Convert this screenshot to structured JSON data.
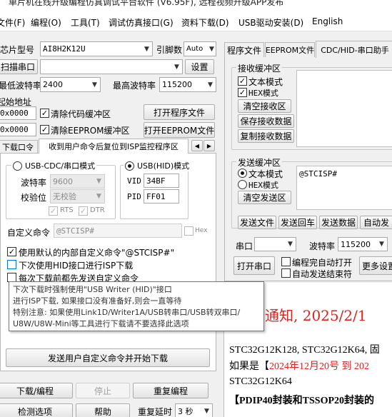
{
  "window": {
    "title": "单片机在线升级编程仿真调试平台软件 (V6.95F), 远程视频升级APP发布"
  },
  "menu": [
    "文件(F)",
    "编程(O)",
    "工具(T)",
    "调试仿真接口(G)",
    "资料下载(D)",
    "USB驱动安装(D)",
    "English"
  ],
  "left": {
    "chip_label": "芯片型号",
    "chip_value": "AI8H2K12U",
    "pins_label": "引脚数",
    "pins_value": "Auto",
    "scan_port_label": "扫描串口",
    "scan_port_value": "",
    "settings_btn": "设置",
    "min_baud_label": "最低波特率",
    "min_baud_value": "2400",
    "max_baud_label": "最高波特率",
    "max_baud_value": "115200",
    "start_addr_label": "起始地址",
    "addr1": "0x0000",
    "clear_code_label": "清除代码缓冲区",
    "open_program_btn": "打开程序文件",
    "addr2": "0x0000",
    "clear_eeprom_label": "清除EEPROM缓冲区",
    "open_eeprom_btn": "打开EEPROM文件",
    "tabs": [
      "下载口令",
      "收到用户命令后复位到ISP监控程序区"
    ],
    "usb_cdc_label": "USB-CDC/串口模式",
    "usb_hid_label": "USB(HID)模式",
    "baud_label": "波特率",
    "baud_value": "9600",
    "parity_label": "校验位",
    "parity_value": "无校验",
    "rts_label": "RTS",
    "dtr_label": "DTR",
    "vid_label": "VID",
    "vid_value": "34BF",
    "pid_label": "PID",
    "pid_value": "FF01",
    "custom_cmd_label": "自定义命令",
    "custom_cmd_value": "@STCISP#",
    "hex_label": "Hex",
    "opt1": "使用默认的内部自定义命令\"@STCISP#\"",
    "opt2": "下次使用HID接口进行ISP下载",
    "opt3": "每次下载前都先发送自定义命令",
    "tooltip": [
      "下次下载时强制使用\"USB Writer (HID)\"接口",
      "进行ISP下载, 如果接口没有准备好,则会一直等待",
      "特别注意: 如果使用Link1D/Writer1A/USB转串口/USB转双串口/",
      "U8W/U8W-Mini等工具进行下载请不要选择此选项"
    ],
    "send_custom_btn": "发送用户自定义命令并开始下载",
    "download_btn": "下载/编程",
    "stop_btn": "停止",
    "reprogram_btn": "重复编程",
    "detect_btn": "检测选项",
    "help_btn": "帮助",
    "repeat_delay_label": "重复延时",
    "repeat_delay_value": "3 秒"
  },
  "right": {
    "tabs": [
      "程序文件",
      "EEPROM文件",
      "CDC/HID-串口助手"
    ],
    "recv_group": "接收缓冲区",
    "recv_text": "文本模式",
    "recv_hex": "HEX模式",
    "clear_recv_btn": "清空接收区",
    "save_recv_btn": "保存接收数据",
    "copy_recv_btn": "复制接收数据",
    "send_group": "发送缓冲区",
    "send_text": "文本模式",
    "send_hex": "HEX模式",
    "send_content": "@STCISP#",
    "clear_send_btn": "清空发送区",
    "send_file_btn": "发送文件",
    "send_return_btn": "发送回车",
    "send_data_btn": "发送数据",
    "auto_send_btn": "自动发",
    "port_label": "串口",
    "baud_label": "波特率",
    "baud_value": "115200",
    "open_port_btn": "打开串口",
    "auto_open_label": "编程完自动打开",
    "auto_end_label": "自动发送结束符",
    "more_settings_btn": "更多设置",
    "notice_title": "通知, 2025/2/1",
    "notice_line1": "STC32G12K128, STC32G12K64, 固",
    "notice_line2_pre": "如果是【",
    "notice_line2_red": "2024年12月20号 到 202",
    "notice_line3": "STC32G12K64",
    "notice_line4": "【PDIP40封装和TSSOP20封装的"
  },
  "colors": {
    "notice_red": "#e0201b",
    "accent_blue": "#0078d7"
  }
}
